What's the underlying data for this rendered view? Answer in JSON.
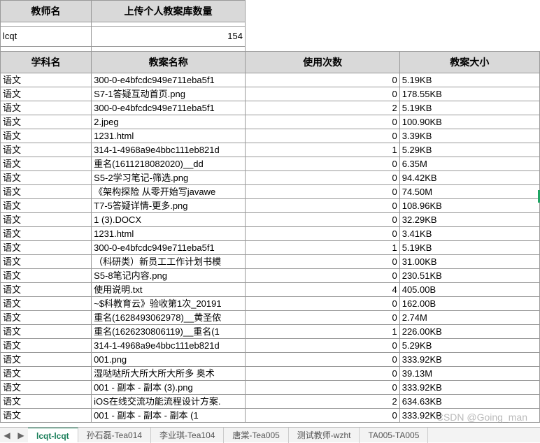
{
  "summary_header": {
    "teacher_name_label": "教师名",
    "upload_count_label": "上传个人教案库数量"
  },
  "summary_row": {
    "teacher_name": "lcqt",
    "upload_count": "154"
  },
  "main_header": {
    "subject": "学科名",
    "name": "教案名称",
    "count": "使用次数",
    "size": "教案大小"
  },
  "rows": [
    {
      "subject": "语文",
      "name": "300-0-e4bfcdc949e711eba5f1",
      "count": "0",
      "size": "5.19KB"
    },
    {
      "subject": "语文",
      "name": "S7-1答疑互动首页.png",
      "count": "0",
      "size": "178.55KB"
    },
    {
      "subject": "语文",
      "name": "300-0-e4bfcdc949e711eba5f1",
      "count": "2",
      "size": "5.19KB"
    },
    {
      "subject": "语文",
      "name": "2.jpeg",
      "count": "0",
      "size": "100.90KB"
    },
    {
      "subject": "语文",
      "name": "1231.html",
      "count": "0",
      "size": "3.39KB"
    },
    {
      "subject": "语文",
      "name": "314-1-4968a9e4bbc111eb821d",
      "count": "1",
      "size": "5.29KB"
    },
    {
      "subject": "语文",
      "name": "重名(1611218082020)__dd",
      "count": "0",
      "size": "6.35M"
    },
    {
      "subject": "语文",
      "name": "S5-2学习笔记-筛选.png",
      "count": "0",
      "size": "94.42KB"
    },
    {
      "subject": "语文",
      "name": "《架构探险 从零开始写javawe",
      "count": "0",
      "size": "74.50M"
    },
    {
      "subject": "语文",
      "name": "T7-5答疑详情-更多.png",
      "count": "0",
      "size": "108.96KB"
    },
    {
      "subject": "语文",
      "name": "1 (3).DOCX",
      "count": "0",
      "size": "32.29KB"
    },
    {
      "subject": "语文",
      "name": "1231.html",
      "count": "0",
      "size": "3.41KB"
    },
    {
      "subject": "语文",
      "name": "300-0-e4bfcdc949e711eba5f1",
      "count": "1",
      "size": "5.19KB"
    },
    {
      "subject": "语文",
      "name": "（科研类）新员工工作计划书模",
      "count": "0",
      "size": "31.00KB"
    },
    {
      "subject": "语文",
      "name": "S5-8笔记内容.png",
      "count": "0",
      "size": "230.51KB"
    },
    {
      "subject": "语文",
      "name": "使用说明.txt",
      "count": "4",
      "size": "405.00B"
    },
    {
      "subject": "语文",
      "name": "~$科教育云》验收第1次_20191",
      "count": "0",
      "size": "162.00B"
    },
    {
      "subject": "语文",
      "name": "重名(1628493062978)__黄圣侬",
      "count": "0",
      "size": "2.74M"
    },
    {
      "subject": "语文",
      "name": "重名(1626230806119)__重名(1",
      "count": "1",
      "size": "226.00KB"
    },
    {
      "subject": "语文",
      "name": "314-1-4968a9e4bbc111eb821d",
      "count": "0",
      "size": "5.29KB"
    },
    {
      "subject": "语文",
      "name": "001.png",
      "count": "0",
      "size": "333.92KB"
    },
    {
      "subject": "语文",
      "name": "湿哒哒所大所大所大所多 奥术",
      "count": "0",
      "size": "39.13M"
    },
    {
      "subject": "语文",
      "name": "001 - 副本 - 副本 (3).png",
      "count": "0",
      "size": "333.92KB"
    },
    {
      "subject": "语文",
      "name": "iOS在线交流功能流程设计方案.",
      "count": "2",
      "size": "634.63KB"
    },
    {
      "subject": "语文",
      "name": "001 - 副本 - 副本 - 副本 (1",
      "count": "0",
      "size": "333.92KB"
    }
  ],
  "sheet_tabs": {
    "active": "lcqt-lcqt",
    "tabs": [
      "lcqt-lcqt",
      "孙石磊-Tea014",
      "李业琪-Tea104",
      "唐棠-Tea005",
      "测试教师-wzht",
      "TA005-TA005"
    ]
  },
  "nav": {
    "prev": "◀",
    "next": "▶"
  },
  "watermark": "CSDN @Going_man"
}
